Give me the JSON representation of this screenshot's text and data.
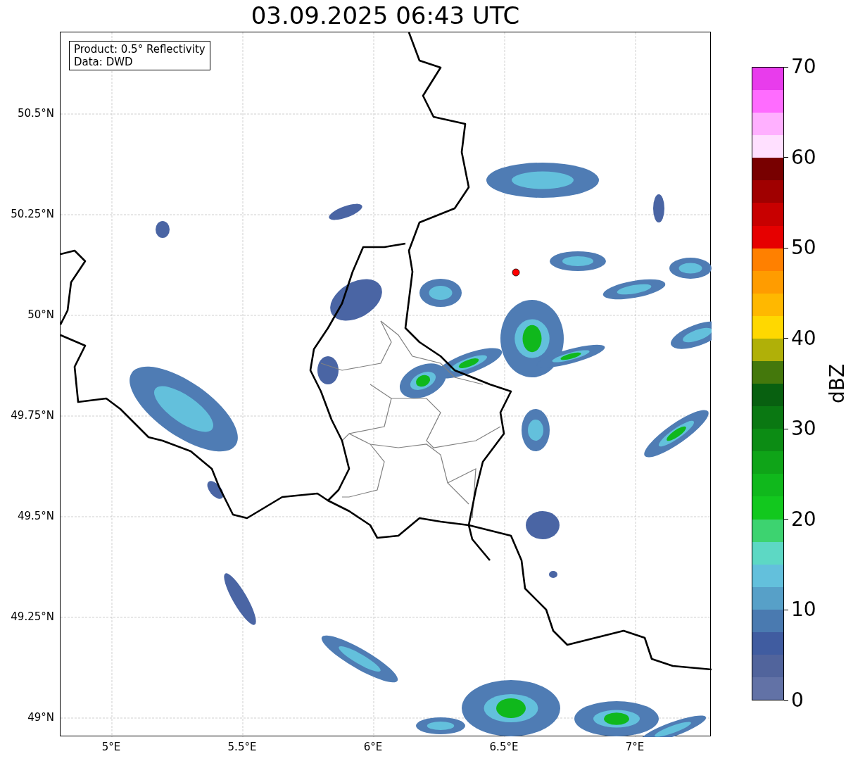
{
  "title": "03.09.2025 06:43 UTC",
  "info_box": {
    "lines": [
      "Product: 0.5° Reflectivity",
      "Data: DWD"
    ]
  },
  "map": {
    "y_ticks": [
      "50.5°N",
      "50.25°N",
      "50°N",
      "49.75°N",
      "49.5°N",
      "49.25°N",
      "49°N"
    ],
    "x_ticks": [
      "5°E",
      "5.5°E",
      "6°E",
      "6.5°E",
      "7°E"
    ]
  },
  "colorbar": {
    "label": "dBZ",
    "ticks": [
      "70",
      "60",
      "50",
      "40",
      "30",
      "20",
      "10",
      "0"
    ],
    "segments": [
      {
        "color": "#e83cec"
      },
      {
        "color": "#ff6cff"
      },
      {
        "color": "#ffb0ff"
      },
      {
        "color": "#ffe0ff"
      },
      {
        "color": "#780000"
      },
      {
        "color": "#a00000"
      },
      {
        "color": "#c80000"
      },
      {
        "color": "#e60000"
      },
      {
        "color": "#ff8000"
      },
      {
        "color": "#ff9c00"
      },
      {
        "color": "#ffb800"
      },
      {
        "color": "#ffd800"
      },
      {
        "color": "#b0b008"
      },
      {
        "color": "#44780c"
      },
      {
        "color": "#086010"
      },
      {
        "color": "#0a7812"
      },
      {
        "color": "#0c8c14"
      },
      {
        "color": "#0fa418"
      },
      {
        "color": "#10b81c"
      },
      {
        "color": "#12c81e"
      },
      {
        "color": "#3dd370"
      },
      {
        "color": "#5dd8c4"
      },
      {
        "color": "#63c0dc"
      },
      {
        "color": "#57a0c8"
      },
      {
        "color": "#4a7ab0"
      },
      {
        "color": "#405ca0"
      },
      {
        "color": "#51649c"
      },
      {
        "color": "#6272a6"
      }
    ]
  }
}
